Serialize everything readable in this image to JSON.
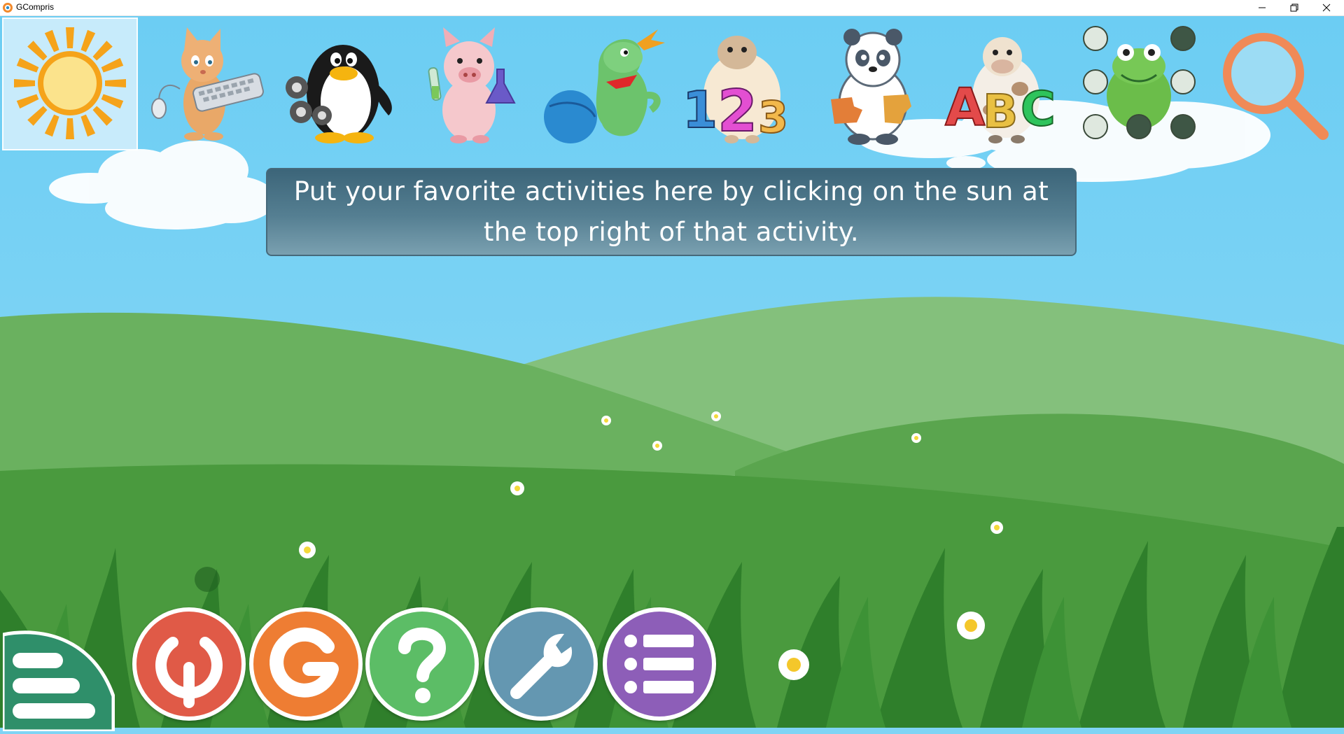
{
  "window": {
    "title": "GCompris",
    "controls": [
      "minimize",
      "restore",
      "close"
    ]
  },
  "activities": [
    {
      "id": "favorites",
      "icon": "sun-icon",
      "selected": true
    },
    {
      "id": "computer",
      "icon": "cat-keyboard-icon",
      "selected": false
    },
    {
      "id": "discovery",
      "icon": "penguin-gears-icon",
      "selected": false
    },
    {
      "id": "sciences",
      "icon": "pig-scientist-icon",
      "selected": false
    },
    {
      "id": "fun",
      "icon": "dragon-ball-icon",
      "selected": false
    },
    {
      "id": "math",
      "icon": "sheep-numbers-icon",
      "selected": false
    },
    {
      "id": "puzzle",
      "icon": "panda-puzzle-icon",
      "selected": false
    },
    {
      "id": "reading",
      "icon": "cow-abc-icon",
      "selected": false
    },
    {
      "id": "strategy",
      "icon": "frog-board-icon",
      "selected": false
    },
    {
      "id": "search",
      "icon": "magnifier-icon",
      "selected": false
    }
  ],
  "message": "Put your favorite activities here by clicking on the sun at the top right of that activity.",
  "bottom_bar": [
    {
      "id": "exit",
      "icon": "power-icon",
      "color": "#e05a47"
    },
    {
      "id": "about",
      "icon": "g-logo-icon",
      "color": "#ee7d33"
    },
    {
      "id": "help",
      "icon": "question-icon",
      "color": "#5cbd66"
    },
    {
      "id": "config",
      "icon": "wrench-icon",
      "color": "#6497b1"
    },
    {
      "id": "activity-list",
      "icon": "list-icon",
      "color": "#8d5eb8"
    }
  ],
  "colors": {
    "sky": "#7fd4f5",
    "hills_back": "#84c07c",
    "hills_mid": "#6aae5e",
    "hills_front": "#4a9a3e",
    "selected_tile": "#d7f0fc"
  }
}
